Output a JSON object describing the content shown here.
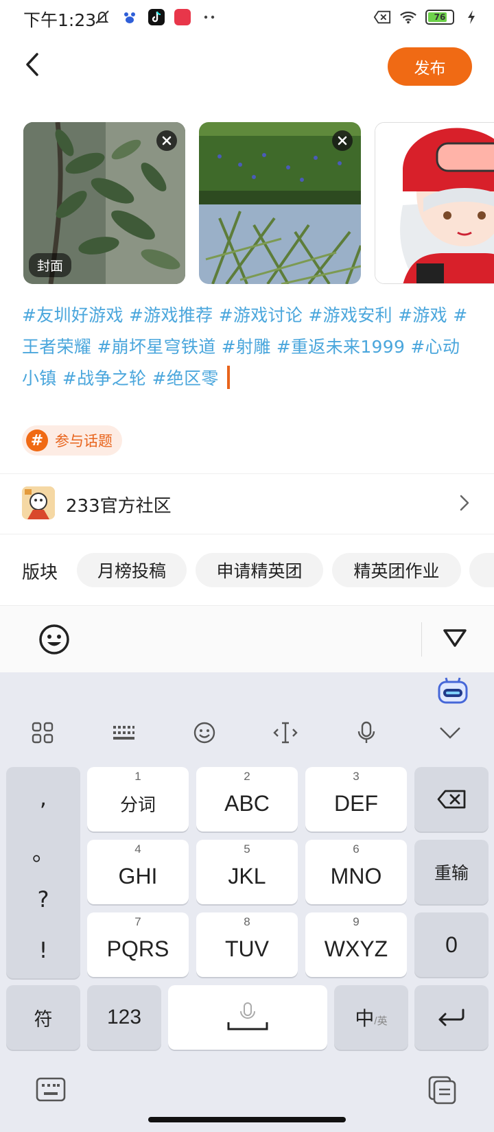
{
  "status": {
    "time": "下午1:23",
    "battery": "76"
  },
  "header": {
    "publish_label": "发布"
  },
  "images": {
    "cover_label": "封面"
  },
  "post": {
    "hashtags": [
      "#友圳好游戏",
      "#游戏推荐",
      "#游戏讨论",
      "#游戏安利",
      "#游戏",
      "#王者荣耀",
      "#崩坏星穹铁道",
      "#射雕",
      "#重返未来1999",
      "#心动小镇",
      "#战争之轮",
      "#绝区零"
    ]
  },
  "topic": {
    "icon": "#",
    "label": "参与话题"
  },
  "community": {
    "name": "233官方社区"
  },
  "section": {
    "label": "版块",
    "pills": [
      "月榜投稿",
      "申请精英团",
      "精英团作业"
    ]
  },
  "keyboard": {
    "punct": [
      ",",
      "。",
      "?",
      "!"
    ],
    "rows": [
      [
        {
          "num": "1",
          "label": "分词"
        },
        {
          "num": "2",
          "label": "ABC"
        },
        {
          "num": "3",
          "label": "DEF"
        }
      ],
      [
        {
          "num": "4",
          "label": "GHI"
        },
        {
          "num": "5",
          "label": "JKL"
        },
        {
          "num": "6",
          "label": "MNO"
        }
      ],
      [
        {
          "num": "7",
          "label": "PQRS"
        },
        {
          "num": "8",
          "label": "TUV"
        },
        {
          "num": "9",
          "label": "WXYZ"
        }
      ]
    ],
    "reinput": "重输",
    "zero": "0",
    "symbols": "符",
    "numbers": "123",
    "lang_main": "中",
    "lang_sub": "/英"
  }
}
